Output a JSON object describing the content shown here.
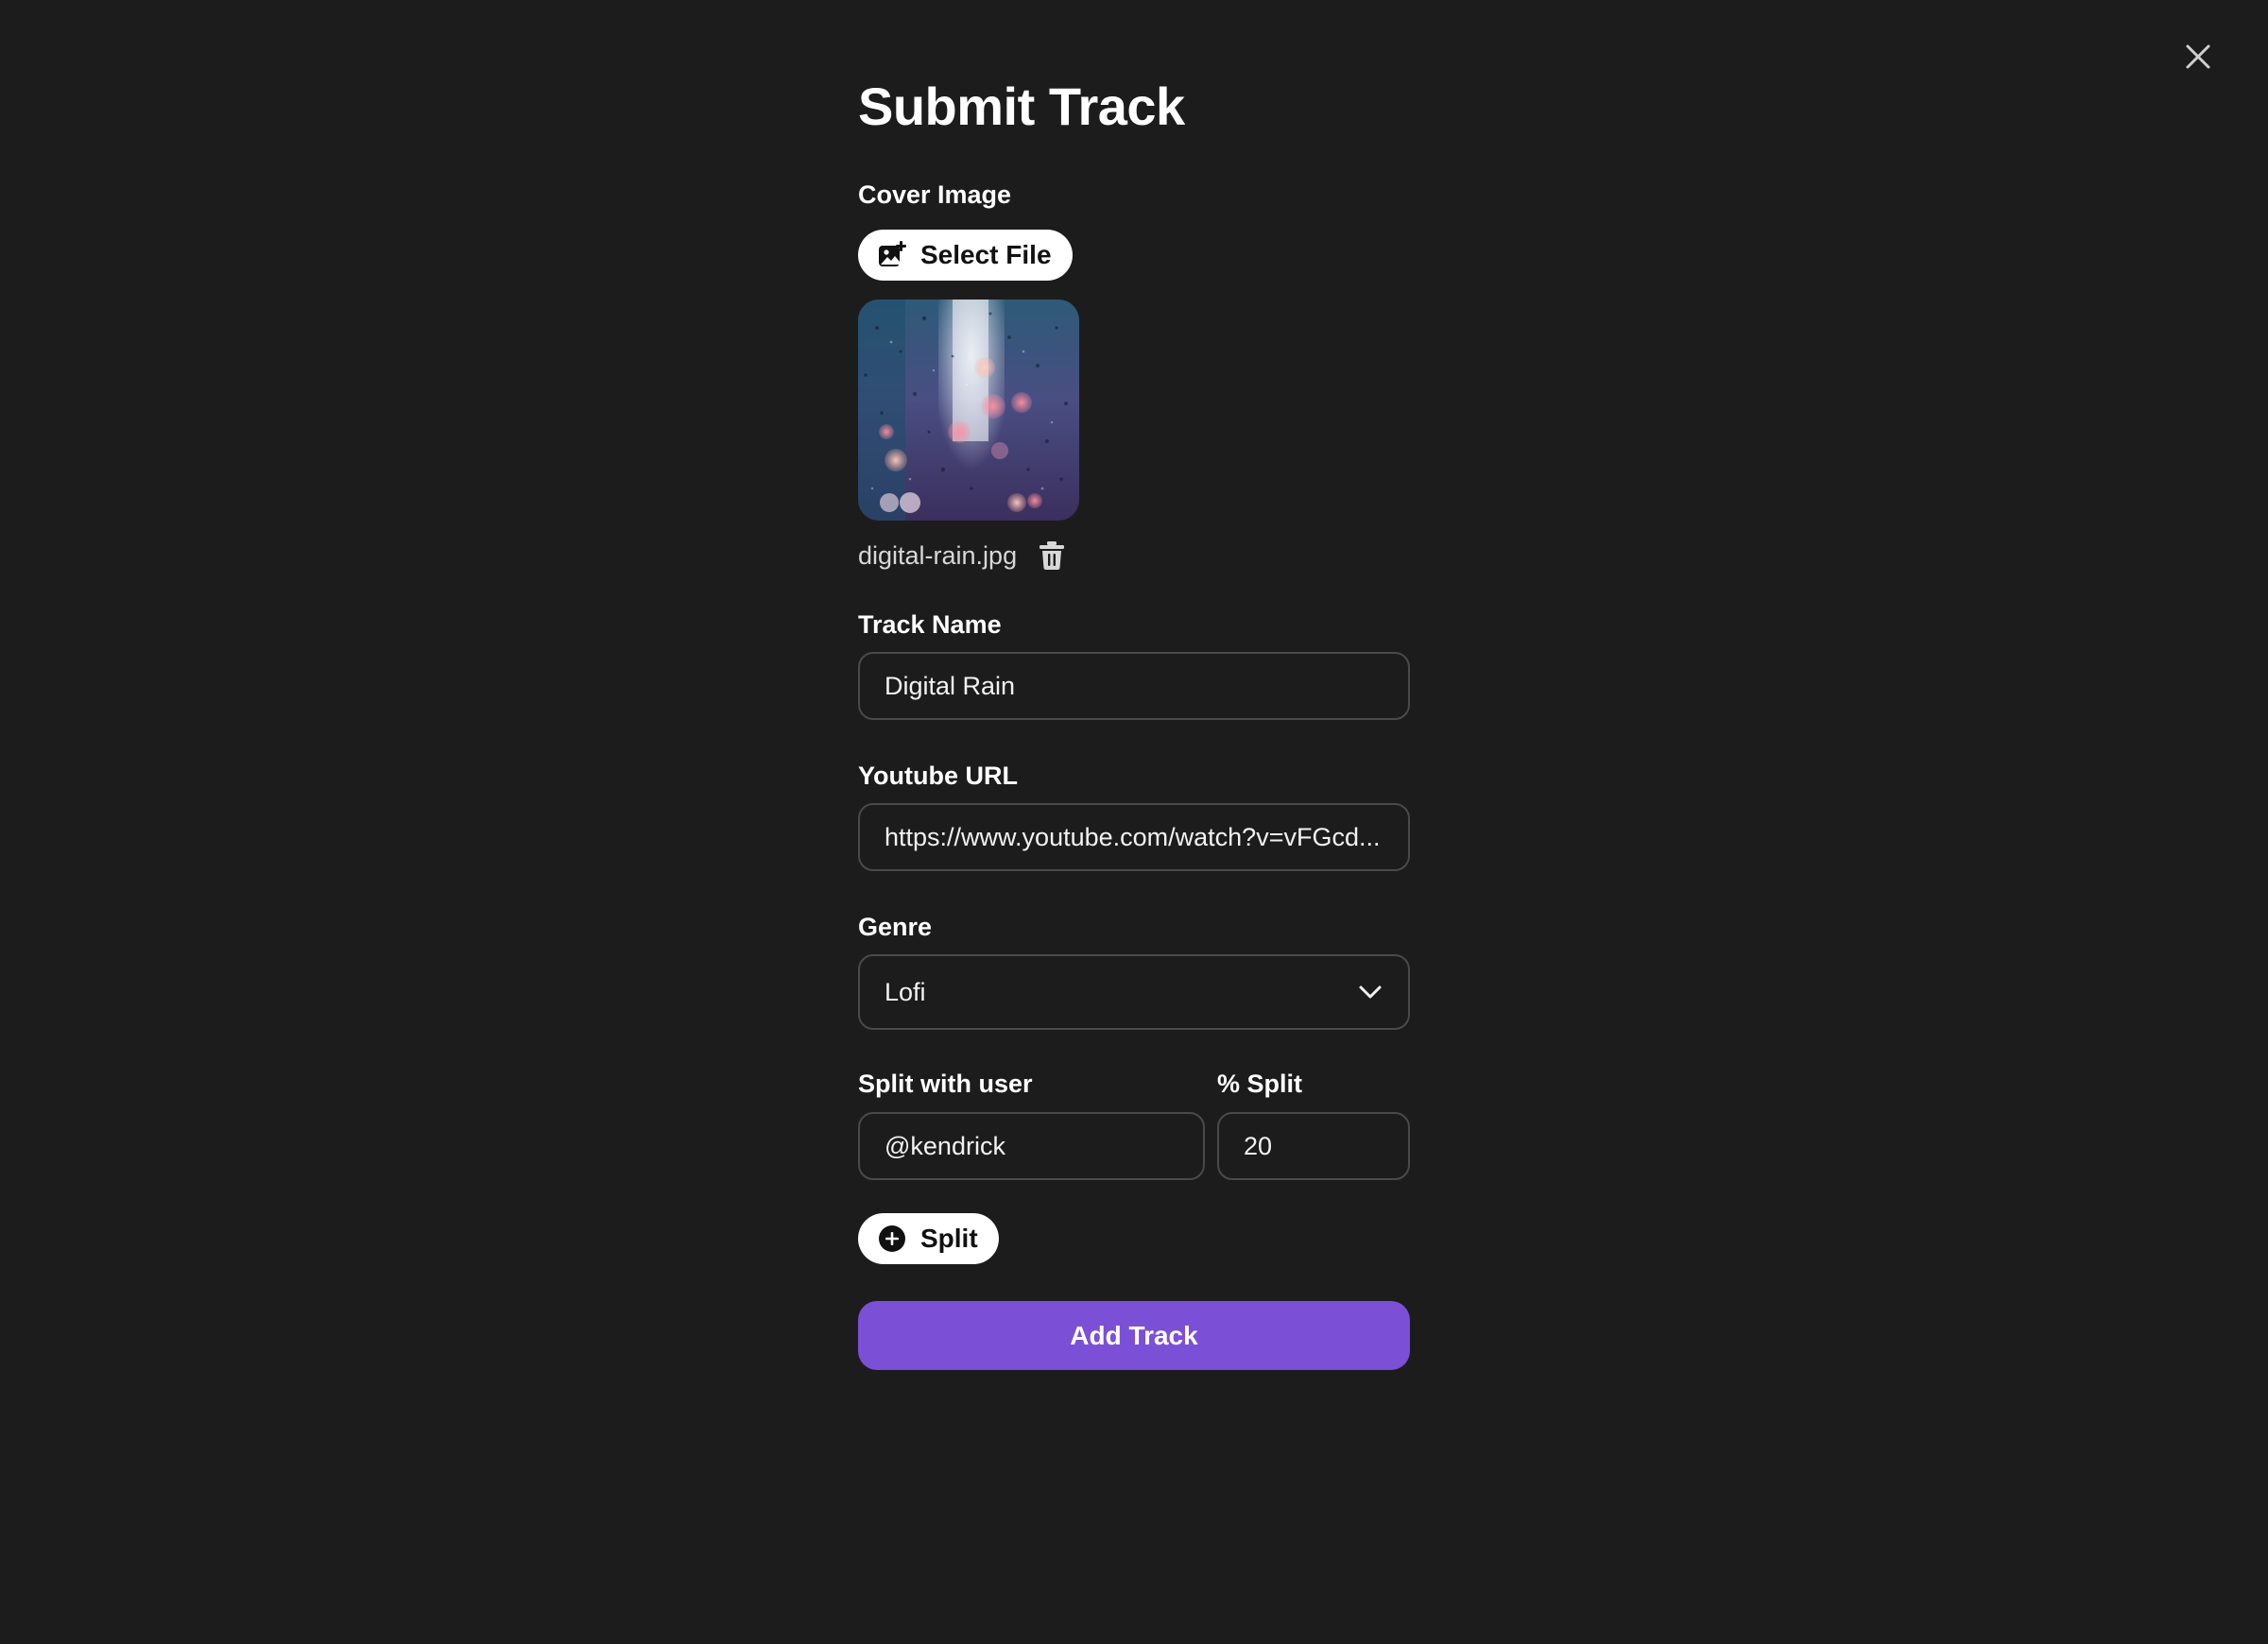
{
  "dialog": {
    "title": "Submit Track",
    "close_icon": "close-icon"
  },
  "cover_image": {
    "label": "Cover Image",
    "select_button_label": "Select File",
    "select_icon": "add-image-icon",
    "file_name": "digital-rain.jpg",
    "delete_icon": "trash-icon"
  },
  "track_name": {
    "label": "Track Name",
    "value": "Digital Rain"
  },
  "youtube_url": {
    "label": "Youtube URL",
    "value": "https://www.youtube.com/watch?v=vFGcd..."
  },
  "genre": {
    "label": "Genre",
    "selected": "Lofi",
    "chevron_icon": "chevron-down-icon"
  },
  "split": {
    "user_label": "Split with user",
    "user_value": "@kendrick",
    "percent_label": "% Split",
    "percent_value": "20",
    "add_button_label": "Split",
    "add_icon": "plus-circle-icon"
  },
  "submit": {
    "label": "Add Track"
  },
  "colors": {
    "background": "#1c1c1c",
    "accent": "#7b4fd6",
    "field_border": "#4a4a4a",
    "text": "#ffffff"
  }
}
